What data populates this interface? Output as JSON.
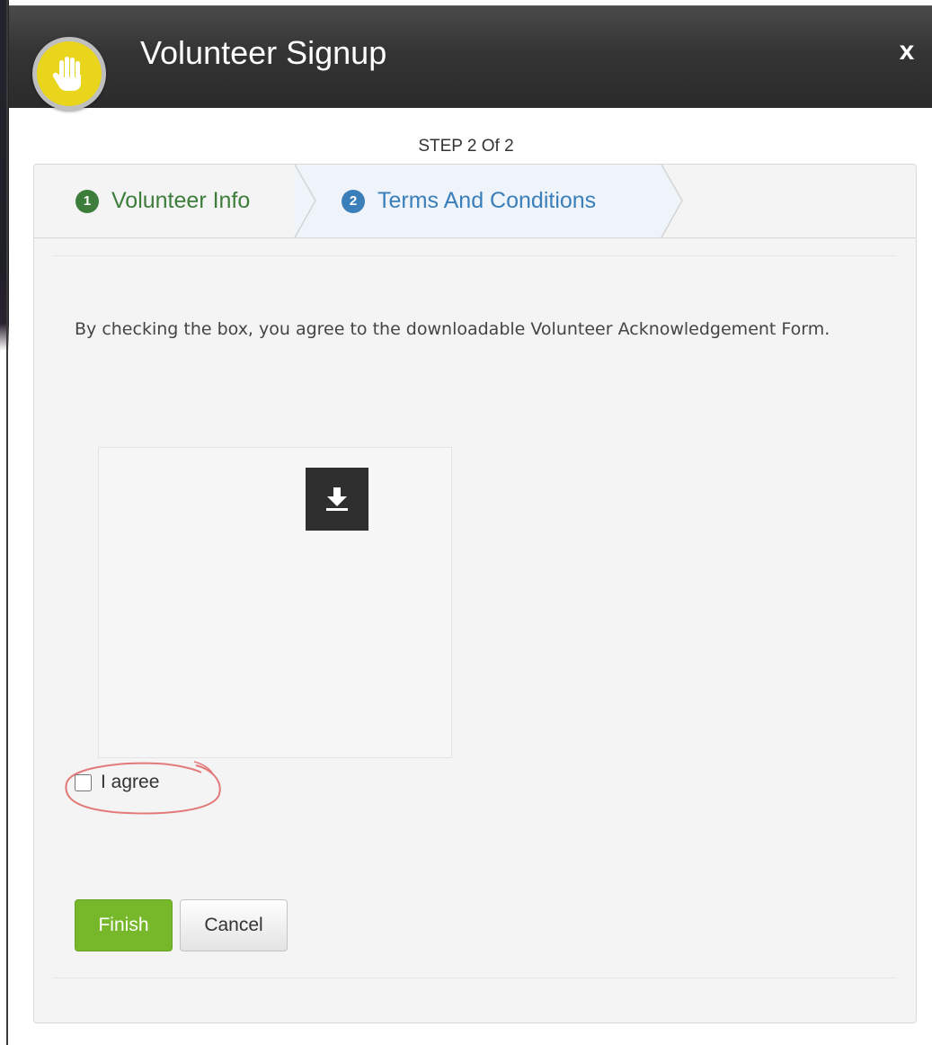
{
  "header": {
    "title": "Volunteer Signup",
    "close_label": "x"
  },
  "progress": {
    "step_text": "STEP 2 Of 2"
  },
  "steps": [
    {
      "number": "1",
      "label": "Volunteer Info",
      "color": "#3d7d3b"
    },
    {
      "number": "2",
      "label": "Terms And Conditions",
      "color": "#3a7fba",
      "active": true
    }
  ],
  "form": {
    "description": "By checking the box, you agree to the downloadable Volunteer Acknowledgement Form.",
    "download_icon": "download-icon",
    "agree_label": "I agree",
    "agree_checked": false
  },
  "buttons": {
    "finish": "Finish",
    "cancel": "Cancel"
  },
  "colors": {
    "header_bg": "#343434",
    "finish_bg": "#76b82a",
    "logo_yellow": "#e8d51c"
  }
}
